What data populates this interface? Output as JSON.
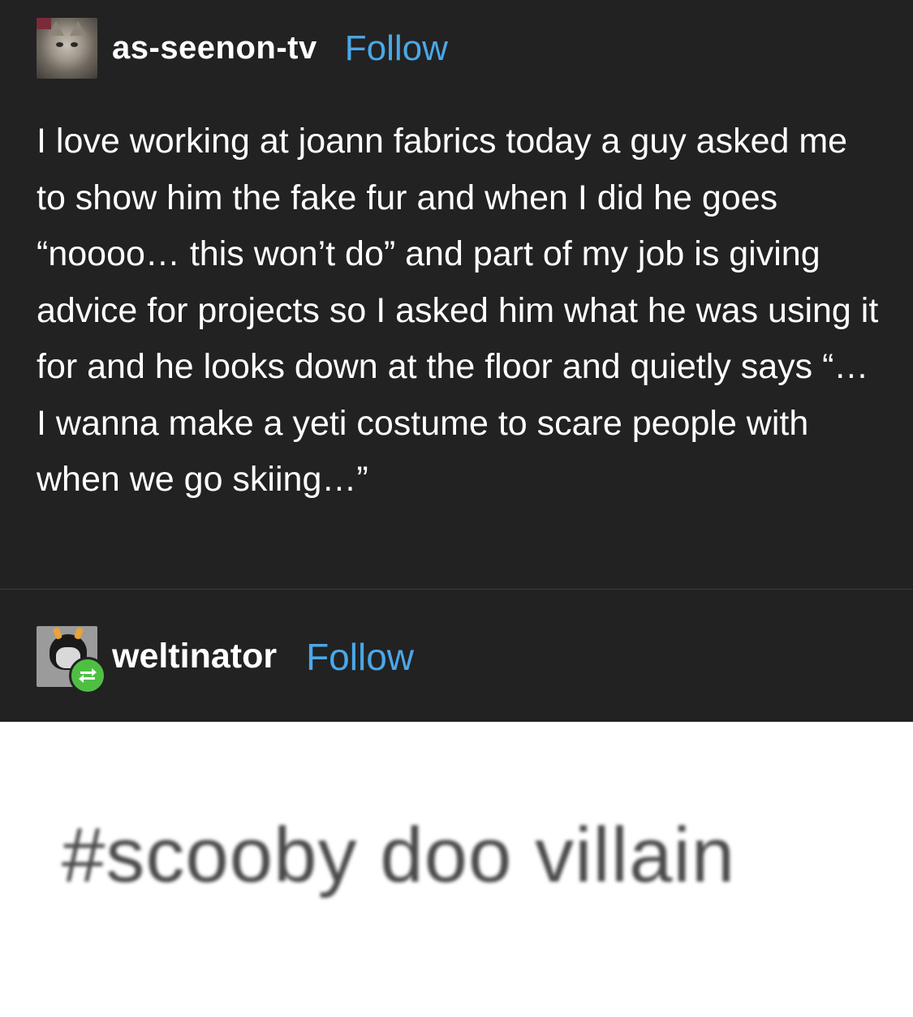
{
  "post": {
    "author": {
      "username": "as-seenon-tv",
      "follow_label": "Follow",
      "avatar_icon": "cat-avatar-icon"
    },
    "body": "I love working at joann fabrics today a guy asked me to show him the fake fur and when I did he goes “noooo… this won’t do” and part of my job is giving advice for projects so I asked him what he was using it for and he looks down at the floor and quietly says “… I wanna make a yeti costume to scare people with when we go skiing…”"
  },
  "reblog": {
    "username": "weltinator",
    "follow_label": "Follow",
    "avatar_icon": "troll-avatar-icon",
    "badge_icon": "reblog-icon"
  },
  "tags": {
    "text": "#scooby doo villain"
  },
  "colors": {
    "background_dark": "#222222",
    "follow_blue": "#4aa8e8",
    "reblog_green": "#4fbf44"
  }
}
